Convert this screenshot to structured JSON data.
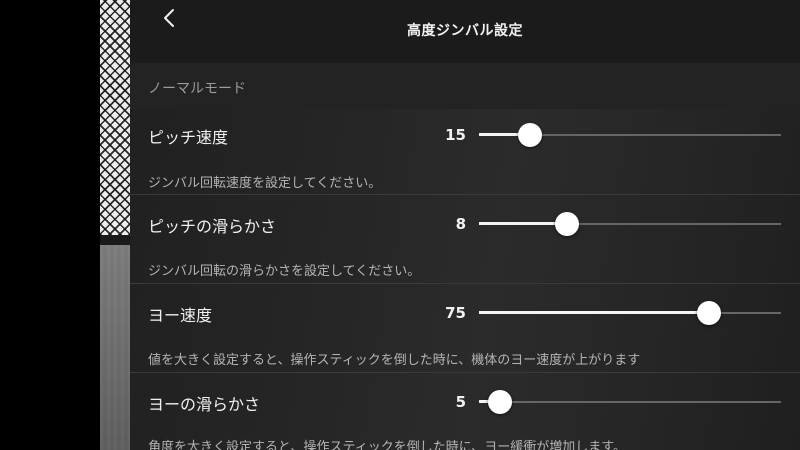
{
  "header": {
    "title": "高度ジンバル設定",
    "back_icon": "chevron-left-icon"
  },
  "section": {
    "title": "ノーマルモード"
  },
  "settings": [
    {
      "label": "ピッチ速度",
      "value": "15",
      "level_percent": 17,
      "description": "ジンバル回転速度を設定してください。"
    },
    {
      "label": "ピッチの滑らかさ",
      "value": "8",
      "level_percent": 29,
      "description": "ジンバル回転の滑らかさを設定してください。"
    },
    {
      "label": "ヨー速度",
      "value": "75",
      "level_percent": 76,
      "description": "値を大きく設定すると、操作スティックを倒した時に、機体のヨー速度が上がります"
    },
    {
      "label": "ヨーの滑らかさ",
      "value": "5",
      "level_percent": 7,
      "description": "角度を大きく設定すると、操作スティックを倒した時に、ヨー緩衝が増加します。"
    }
  ],
  "colors": {
    "panel_background": "#262626",
    "slider_fill": "#f5f5f5",
    "slider_track": "#666666",
    "knob": "#ffffff"
  }
}
